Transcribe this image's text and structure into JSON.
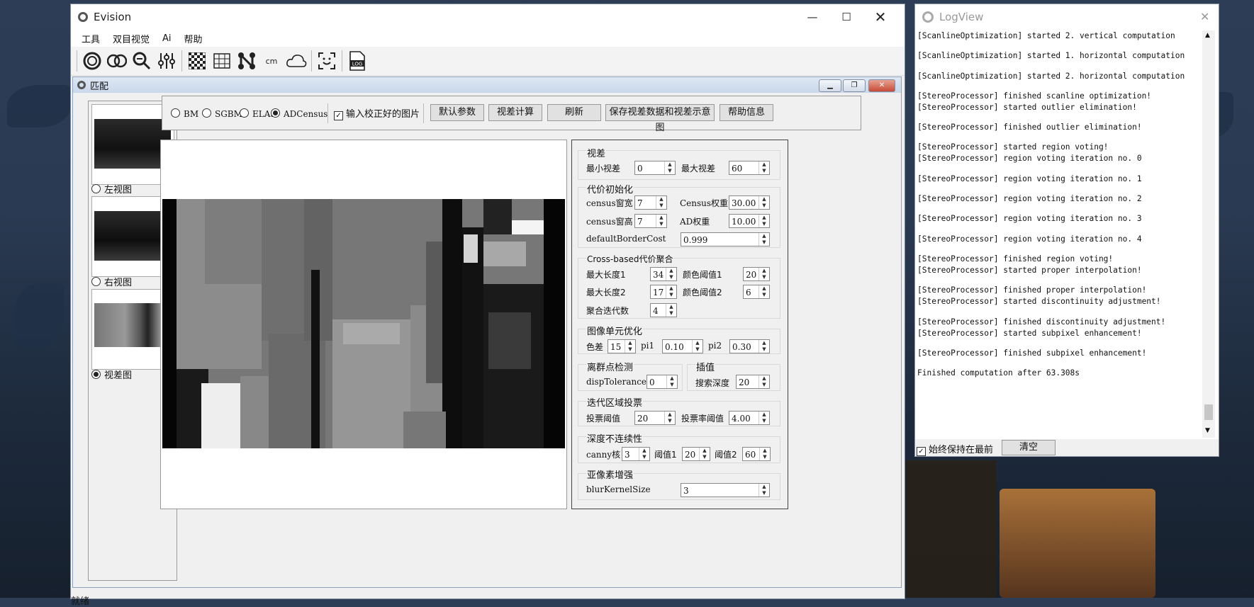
{
  "main_window": {
    "title": "Evision",
    "menu": [
      "工具",
      "双目视觉",
      "Ai",
      "帮助"
    ],
    "toolbar_icons": [
      "camera-ring-icon",
      "stereo-camera-icon",
      "zoom-icon",
      "sliders-icon",
      "checkerboard-icon",
      "grid-icon",
      "graph-nodes-icon",
      "cm-icon",
      "cloud-icon",
      "face-scan-icon",
      "log-icon"
    ],
    "status": "就绪"
  },
  "sub_window": {
    "title": "匹配",
    "thumbnails": [
      {
        "label": "左视图",
        "selected": false
      },
      {
        "label": "右视图",
        "selected": false
      },
      {
        "label": "视差图",
        "selected": true
      }
    ],
    "algorithms": [
      {
        "label": "BM",
        "selected": false
      },
      {
        "label": "SGBM",
        "selected": false
      },
      {
        "label": "ELAS",
        "selected": false
      },
      {
        "label": "ADCensus",
        "selected": true
      }
    ],
    "rectified_checkbox": {
      "label": "输入校正好的图片",
      "checked": true
    },
    "buttons": [
      "默认参数",
      "视差计算",
      "刷新",
      "保存视差数据和视差示意图",
      "帮助信息"
    ]
  },
  "params": {
    "disparity": {
      "title": "视差",
      "min_label": "最小视差",
      "min_value": "0",
      "max_label": "最大视差",
      "max_value": "60"
    },
    "cost_init": {
      "title": "代价初始化",
      "cw_label": "census窗宽",
      "cw_value": "7",
      "cweight_label": "Census权重",
      "cweight_value": "30.00",
      "ch_label": "census窗高",
      "ch_value": "7",
      "adweight_label": "AD权重",
      "adweight_value": "10.00",
      "border_label": "defaultBorderCost",
      "border_value": "0.999"
    },
    "cross": {
      "title": "Cross-based代价聚合",
      "len1_label": "最大长度1",
      "len1_value": "34",
      "col1_label": "颜色阈值1",
      "col1_value": "20",
      "len2_label": "最大长度2",
      "len2_value": "17",
      "col2_label": "颜色阈值2",
      "col2_value": "6",
      "iter_label": "聚合迭代数",
      "iter_value": "4"
    },
    "scanline": {
      "title": "图像单元优化",
      "color_label": "色差",
      "color_value": "15",
      "pi1_label": "pi1",
      "pi1_value": "0.10",
      "pi2_label": "pi2",
      "pi2_value": "0.30"
    },
    "outlier": {
      "title": "离群点检测",
      "tol_label": "dispTolerance",
      "tol_value": "0"
    },
    "interp": {
      "title": "插值",
      "depth_label": "搜索深度",
      "depth_value": "20"
    },
    "voting": {
      "title": "迭代区域投票",
      "vote_label": "投票阈值",
      "vote_value": "20",
      "ratio_label": "投票率阈值",
      "ratio_value": "4.00"
    },
    "discont": {
      "title": "深度不连续性",
      "canny_label": "canny核",
      "canny_value": "3",
      "t1_label": "阈值1",
      "t1_value": "20",
      "t2_label": "阈值2",
      "t2_value": "60"
    },
    "subpixel": {
      "title": "亚像素增强",
      "blur_label": "blurKernelSize",
      "blur_value": "3"
    }
  },
  "log_window": {
    "title": "LogView",
    "lines": [
      "[ScanlineOptimization] started 2. vertical computation",
      "",
      "[ScanlineOptimization] started 1. horizontal computation",
      "",
      "[ScanlineOptimization] started 2. horizontal computation",
      "",
      "[StereoProcessor] finished scanline optimization!",
      "[StereoProcessor] started outlier elimination!",
      "",
      "[StereoProcessor] finished outlier elimination!",
      "",
      "[StereoProcessor] started region voting!",
      "[StereoProcessor] region voting iteration no. 0",
      "",
      "[StereoProcessor] region voting iteration no. 1",
      "",
      "[StereoProcessor] region voting iteration no. 2",
      "",
      "[StereoProcessor] region voting iteration no. 3",
      "",
      "[StereoProcessor] region voting iteration no. 4",
      "",
      "[StereoProcessor] finished region voting!",
      "[StereoProcessor] started proper interpolation!",
      "",
      "[StereoProcessor] finished proper interpolation!",
      "[StereoProcessor] started discontinuity adjustment!",
      "",
      "[StereoProcessor] finished discontinuity adjustment!",
      "[StereoProcessor] started subpixel enhancement!",
      "",
      "[StereoProcessor] finished subpixel enhancement!",
      "",
      "Finished computation after 63.308s"
    ],
    "always_on_top": {
      "label": "始终保持在最前",
      "checked": true
    },
    "clear_label": "清空"
  }
}
